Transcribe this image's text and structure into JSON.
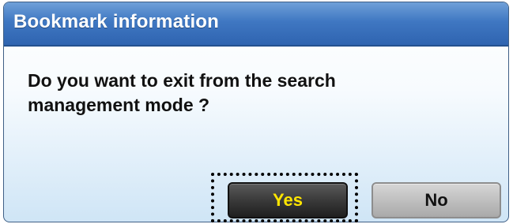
{
  "dialog": {
    "title": "Bookmark information",
    "message": "Do you want to exit from the search\nmanagement mode ?",
    "buttons": {
      "yes_label": "Yes",
      "no_label": "No"
    }
  },
  "colors": {
    "titlebar": "#3f77c2",
    "title_text": "#ffffff",
    "yes_text": "#ffe600",
    "yes_background": "#2b2b2b",
    "no_background": "#bdbdbd"
  }
}
